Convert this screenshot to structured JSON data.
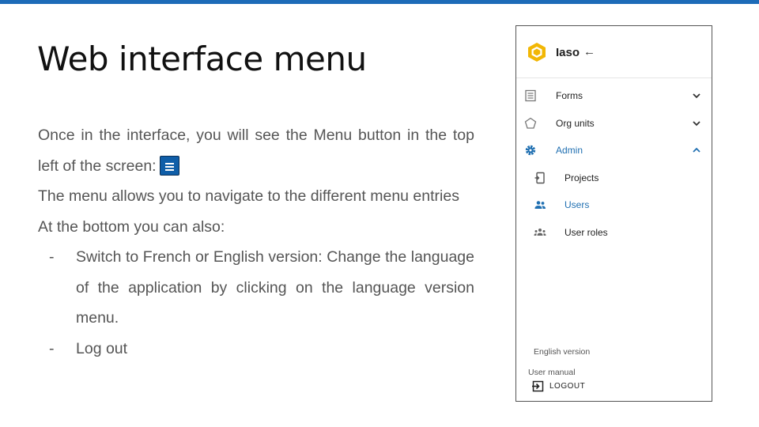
{
  "slide": {
    "title": "Web interface menu",
    "line1": "Once in the interface, you will see the Menu button in the top left of the screen:",
    "line2": "The menu allows you to navigate to the different menu entries",
    "line3": "At the bottom you can also:",
    "bullets": [
      "Switch to French or English version: Change the language of the application by clicking on the language version menu.",
      "Log out"
    ],
    "bullet_marker": "-"
  },
  "panel": {
    "app_name": "Iaso",
    "items": [
      {
        "label": "Forms",
        "icon": "forms-icon",
        "expanded": false
      },
      {
        "label": "Org units",
        "icon": "pentagon-icon",
        "expanded": false
      },
      {
        "label": "Admin",
        "icon": "gear-icon",
        "expanded": true,
        "active": true
      }
    ],
    "sub_items": [
      {
        "label": "Projects",
        "icon": "projects-icon"
      },
      {
        "label": "Users",
        "icon": "users-icon",
        "active": true
      },
      {
        "label": "User roles",
        "icon": "user-roles-icon"
      }
    ],
    "language": "English version",
    "user_manual": "User manual",
    "logout": "LOGOUT"
  },
  "colors": {
    "accent": "#1d6bb8",
    "menu_button": "#0f5ea8",
    "active_item": "#1f6fb1",
    "logo": "#f2b705"
  }
}
